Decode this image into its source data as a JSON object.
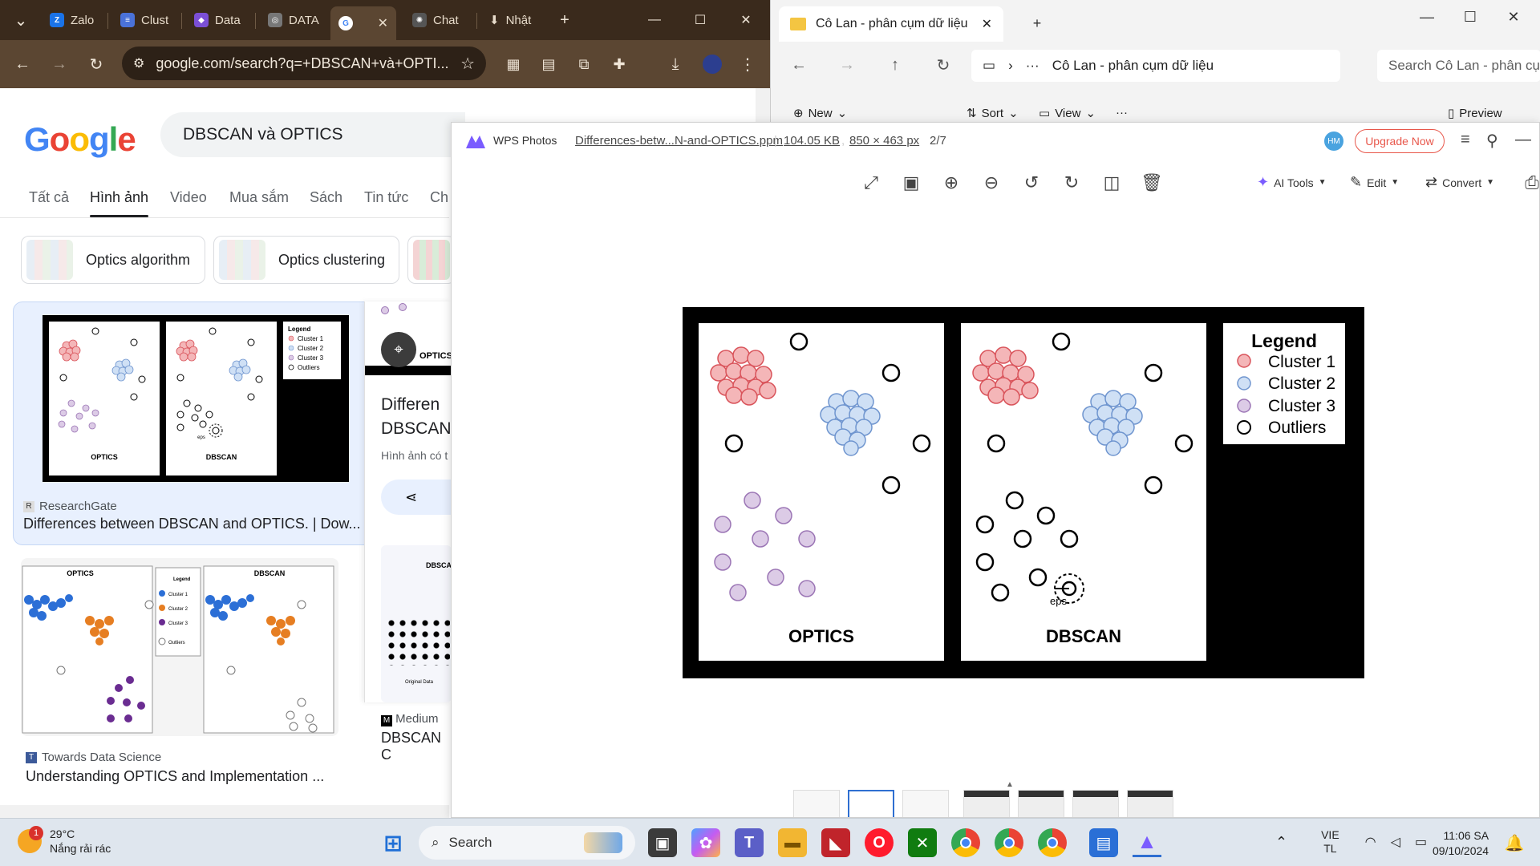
{
  "chrome": {
    "tabs": [
      {
        "label": "Zalo",
        "color": "#1a73e8",
        "glyph": "Z"
      },
      {
        "label": "Clust",
        "color": "#4a72d9",
        "glyph": "≡"
      },
      {
        "label": "Data",
        "color": "#7b4fd6",
        "glyph": "◆"
      },
      {
        "label": "DATA",
        "color": "#666666",
        "glyph": "◎"
      },
      {
        "label": "G",
        "color": "#ffffff",
        "glyph": "G"
      },
      {
        "label": "Chat",
        "color": "#555555",
        "glyph": "✺"
      },
      {
        "label": "Nhật",
        "color": "#e8dccb",
        "glyph": "⬇"
      }
    ],
    "url": "google.com/search?q=+DBSCAN+và+OPTI..."
  },
  "google": {
    "logo": "Google",
    "query": "DBSCAN và OPTICS",
    "tabs": [
      "Tất cả",
      "Hình ảnh",
      "Video",
      "Mua sắm",
      "Sách",
      "Tin tức",
      "Ch"
    ],
    "chips": [
      "Optics algorithm",
      "Optics clustering"
    ],
    "results": [
      {
        "source": "ResearchGate",
        "title": "Differences between DBSCAN and OPTICS. | Dow..."
      },
      {
        "source": "Towards Data Science",
        "title": "Understanding OPTICS and Implementation ..."
      },
      {
        "source": "Medium",
        "title": "DBSCAN C"
      },
      {
        "preview_title": "Differen",
        "preview_title2": "DBSCAN",
        "preview_sub": "Hình ảnh có t",
        "preview_label": "OPTICS"
      }
    ],
    "thumb_labels": {
      "optics": "OPTICS",
      "dbscan": "DBSCAN",
      "legend": "Legend",
      "cluster1": "Cluster 1",
      "cluster2": "Cluster 2",
      "cluster3": "Cluster 3",
      "outliers": "Outliers",
      "eps": "eps",
      "dbscan_small": "DBSCAN",
      "original": "Original Data"
    }
  },
  "explorer": {
    "tab_title": "Cô Lan - phân cụm dữ liệu",
    "address": "Cô Lan - phân cụm dữ liệu",
    "search_placeholder": "Search Cô Lan - phân cụ",
    "commands": [
      "New",
      "Sort",
      "View",
      "Preview"
    ]
  },
  "wps": {
    "app_name": "WPS Photos",
    "file_name": "Differences-betw...N-and-OPTICS.ppm",
    "file_size": "104.05 KB",
    "dimensions": "850 × 463 px",
    "position": "2/7",
    "avatar": "HM",
    "upgrade": "Upgrade Now",
    "buttons": [
      "AI Tools",
      "Edit",
      "Convert"
    ]
  },
  "figure": {
    "left_panel": "OPTICS",
    "right_panel": "DBSCAN",
    "legend_title": "Legend",
    "legend_items": [
      "Cluster 1",
      "Cluster 2",
      "Cluster 3",
      "Outliers"
    ],
    "eps_label": "eps",
    "colors": {
      "cluster1": "#f4b6b8",
      "cluster1_stroke": "#d9535a",
      "cluster2": "#cfe0f5",
      "cluster2_stroke": "#6f95cf",
      "cluster3": "#dccbe6",
      "cluster3_stroke": "#9b75b5"
    }
  },
  "taskbar": {
    "temp": "29°C",
    "weather": "Nắng rải rác",
    "badge": "1",
    "search": "Search",
    "lang1": "VIE",
    "lang2": "TL",
    "time": "11:06 SA",
    "date": "09/10/2024"
  }
}
